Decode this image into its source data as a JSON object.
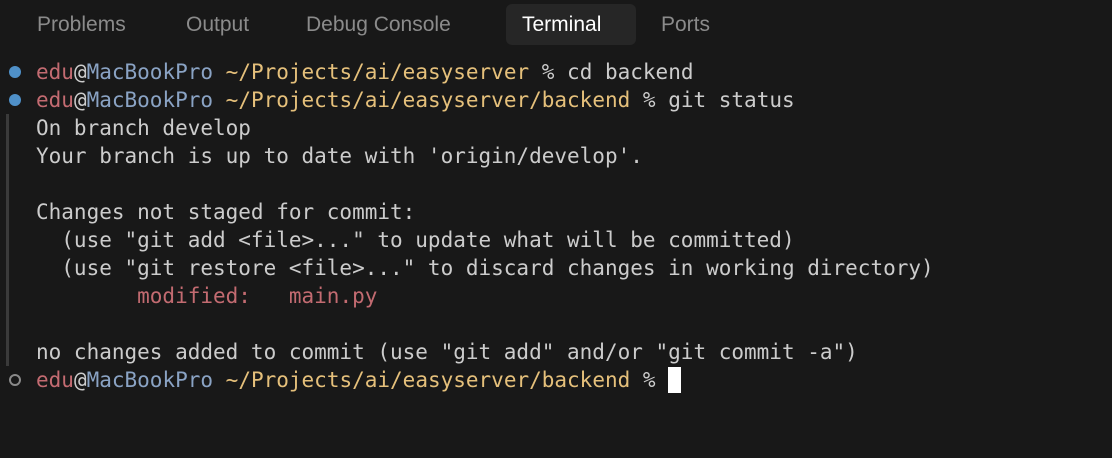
{
  "tabs": [
    {
      "label": "Problems",
      "active": false
    },
    {
      "label": "Output",
      "active": false
    },
    {
      "label": "Debug Console",
      "active": false
    },
    {
      "label": "Terminal",
      "active": true
    },
    {
      "label": "Ports",
      "active": false
    }
  ],
  "terminal": {
    "prompt1": {
      "user": "edu",
      "at": "@",
      "host": "MacBookPro",
      "path": " ~/Projects/ai/easyserver",
      "symbol": " % ",
      "command": "cd backend"
    },
    "prompt2": {
      "user": "edu",
      "at": "@",
      "host": "MacBookPro",
      "path": " ~/Projects/ai/easyserver/backend",
      "symbol": " % ",
      "command": "git status"
    },
    "output": {
      "l1": "On branch develop",
      "l2": "Your branch is up to date with 'origin/develop'.",
      "l3": "Changes not staged for commit:",
      "l4": "  (use \"git add <file>...\" to update what will be committed)",
      "l5": "  (use \"git restore <file>...\" to discard changes in working directory)",
      "modified_label": "        modified:   ",
      "modified_file": "main.py",
      "l7": "no changes added to commit (use \"git add\" and/or \"git commit -a\")"
    },
    "prompt3": {
      "user": "edu",
      "at": "@",
      "host": "MacBookPro",
      "path": " ~/Projects/ai/easyserver/backend",
      "symbol": " % "
    }
  },
  "colors": {
    "background": "#181818",
    "user": "#c36b71",
    "host": "#8aa3c4",
    "path": "#e5c07b",
    "success_dot": "#4f90c8"
  }
}
